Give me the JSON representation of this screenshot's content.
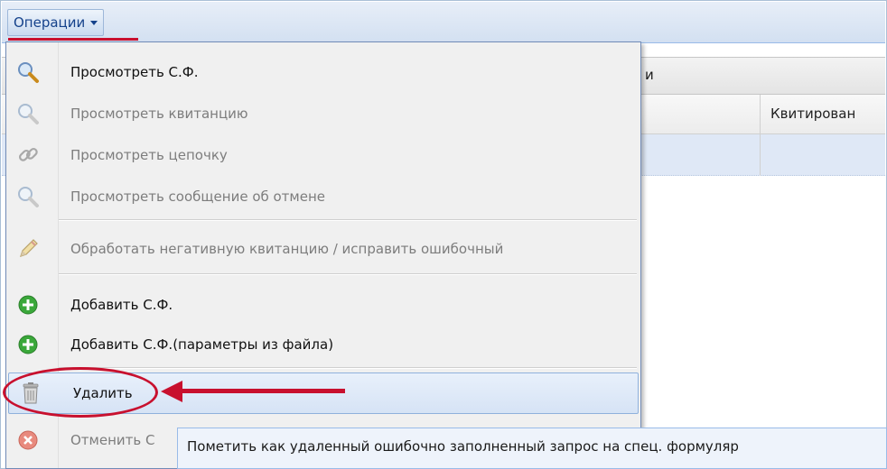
{
  "toolbar": {
    "operations_label": "Операции"
  },
  "panel": {
    "header_partial": "и"
  },
  "grid": {
    "column_kvitirovan": "Квитирован"
  },
  "menu": {
    "items": [
      {
        "label": "Просмотреть С.Ф.",
        "icon": "magnifier-icon",
        "enabled": true
      },
      {
        "label": "Просмотреть квитанцию",
        "icon": "magnifier-icon",
        "enabled": false
      },
      {
        "label": "Просмотреть цепочку",
        "icon": "chain-link-icon",
        "enabled": false
      },
      {
        "label": "Просмотреть сообщение об отмене",
        "icon": "magnifier-icon",
        "enabled": false
      },
      {
        "label": "Обработать негативную квитанцию / исправить ошибочный",
        "icon": "pencil-icon",
        "enabled": false
      },
      {
        "label": "Добавить С.Ф.",
        "icon": "add-circle-icon",
        "enabled": true
      },
      {
        "label": "Добавить С.Ф.(параметры из файла)",
        "icon": "add-circle-icon",
        "enabled": true
      },
      {
        "label": "Удалить",
        "icon": "trash-icon",
        "enabled": true
      },
      {
        "label": "Отменить С",
        "icon": "cancel-circle-icon",
        "enabled": false
      }
    ]
  },
  "tooltip": {
    "text": "Пометить как удаленный ошибочно заполненный запрос на спец. формуляр"
  },
  "colors": {
    "accent_red": "#c8102e",
    "menu_highlight": "#d6e3f5",
    "add_green": "#3aa83a"
  }
}
